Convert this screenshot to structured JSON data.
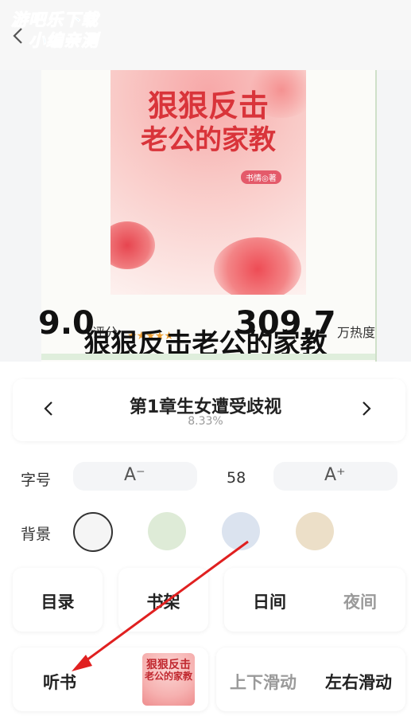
{
  "watermark": {
    "line1": "游吧乐下载",
    "line2": "小编亲测"
  },
  "book": {
    "cover_title_line1": "狠狠反击",
    "cover_title_line2": "老公的家教",
    "cover_author": "书情◎著",
    "title": "狠狠反击老公的家教",
    "score": "9.0",
    "score_label": "评分",
    "stars": "★★★★★",
    "heat": "309.7",
    "heat_label": "万热度"
  },
  "chapter": {
    "title": "第1章生女遭受歧视",
    "progress": "8.33%"
  },
  "settings": {
    "font_label": "字号",
    "font_decrease": "A⁻",
    "font_increase": "A⁺",
    "font_size": "58",
    "bg_label": "背景",
    "backgrounds": [
      "#f5f5f5",
      "#deebd7",
      "#dbe3ef",
      "#ecdfc8"
    ]
  },
  "buttons": {
    "toc": "目录",
    "bookshelf": "书架",
    "day": "日间",
    "night": "夜间",
    "listen": "听书",
    "scroll_vertical": "上下滑动",
    "scroll_horizontal": "左右滑动"
  },
  "mini_cover": {
    "line1": "狠狠反击",
    "line2": "老公的家教"
  },
  "colors": {
    "accent_red": "#d9343a",
    "arrow_red": "#e02020",
    "star": "#f2a43a"
  }
}
